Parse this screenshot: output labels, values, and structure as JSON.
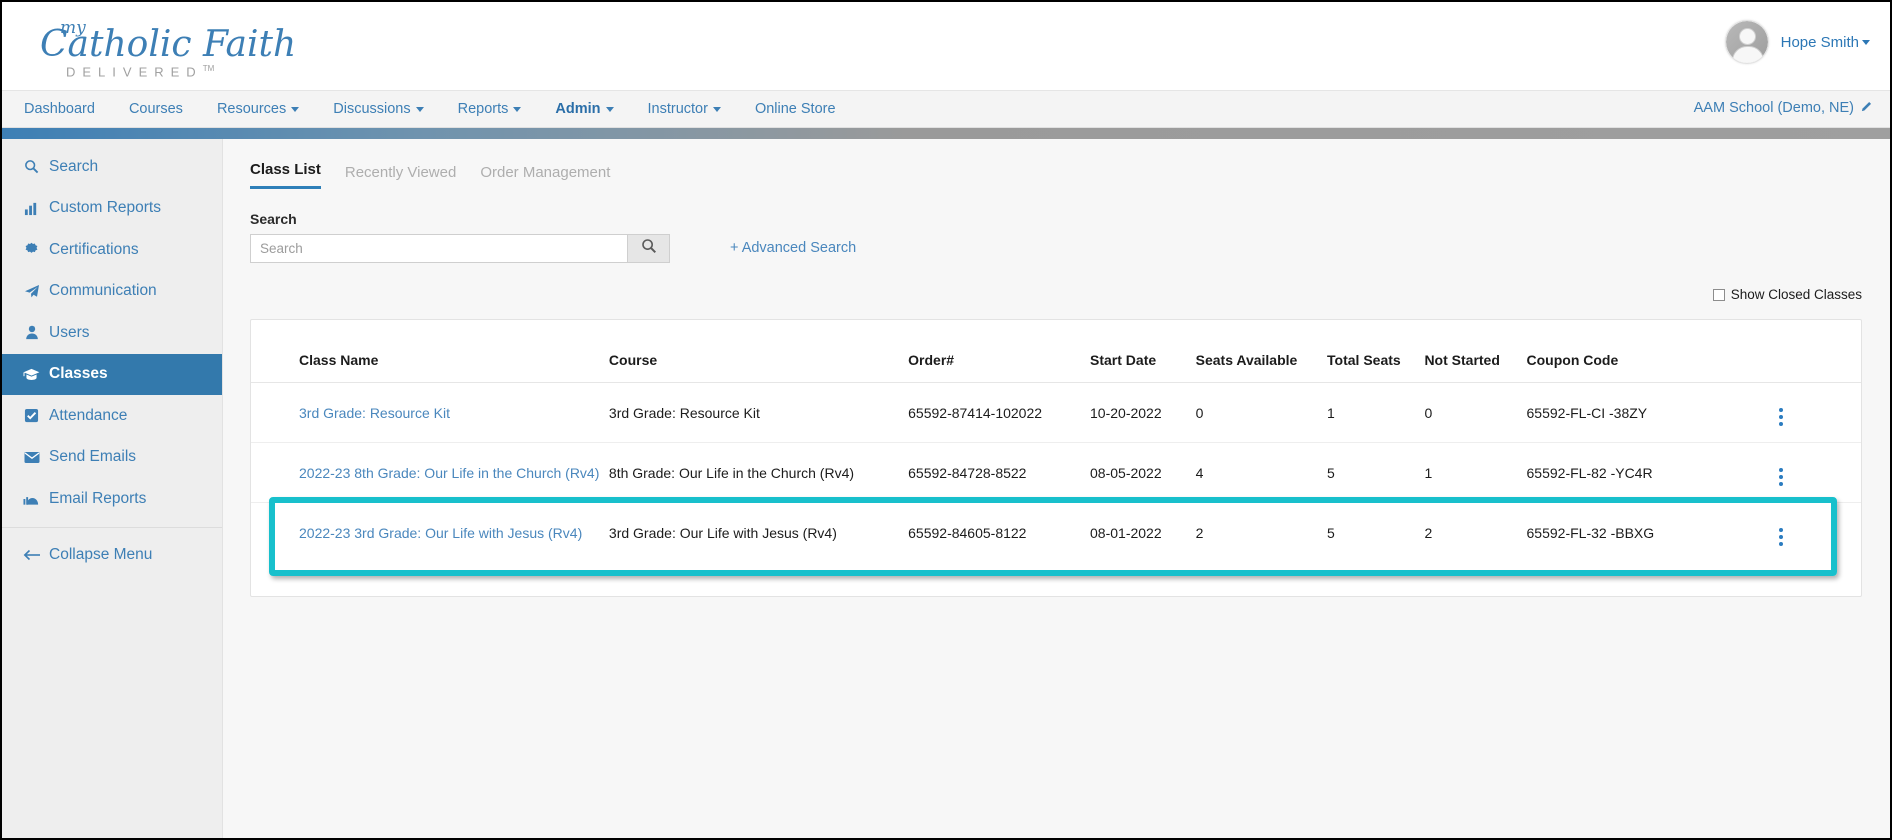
{
  "brand": {
    "logo_my": "my",
    "logo_main": "Catholic Faith",
    "logo_sub": "DELIVERED",
    "logo_tm": "TM",
    "accent_blue": "#3d7fb5",
    "accent_teal": "#18c0cc",
    "active_nav_bg": "#3379ac"
  },
  "header": {
    "user_name": "Hope Smith",
    "user_caret": "caret-down-icon",
    "avatar": "user-avatar"
  },
  "navbar": {
    "items": [
      {
        "label": "Dashboard",
        "caret": false,
        "active": false
      },
      {
        "label": "Courses",
        "caret": false,
        "active": false
      },
      {
        "label": "Resources",
        "caret": true,
        "active": false
      },
      {
        "label": "Discussions",
        "caret": true,
        "active": false
      },
      {
        "label": "Reports",
        "caret": true,
        "active": false
      },
      {
        "label": "Admin",
        "caret": true,
        "active": true
      },
      {
        "label": "Instructor",
        "caret": true,
        "active": false
      },
      {
        "label": "Online Store",
        "caret": false,
        "active": false
      }
    ],
    "school": "AAM School (Demo, NE)",
    "school_edit_icon": "pencil-icon"
  },
  "sidebar": {
    "items": [
      {
        "label": "Search",
        "icon": "magnifier-icon",
        "active": false
      },
      {
        "label": "Custom Reports",
        "icon": "bar-chart-icon",
        "active": false
      },
      {
        "label": "Certifications",
        "icon": "badge-seal-icon",
        "active": false
      },
      {
        "label": "Communication",
        "icon": "paper-plane-icon",
        "active": false
      },
      {
        "label": "Users",
        "icon": "person-icon",
        "active": false
      },
      {
        "label": "Classes",
        "icon": "graduation-cap-icon",
        "active": true
      },
      {
        "label": "Attendance",
        "icon": "checkbox-checked-icon",
        "active": false
      },
      {
        "label": "Send Emails",
        "icon": "envelope-icon",
        "active": false
      },
      {
        "label": "Email Reports",
        "icon": "chart-cloud-icon",
        "active": false
      }
    ],
    "collapse": {
      "label": "Collapse Menu",
      "icon": "arrow-left-icon"
    }
  },
  "main": {
    "tabs": [
      {
        "label": "Class List",
        "active": true
      },
      {
        "label": "Recently Viewed",
        "active": false
      },
      {
        "label": "Order Management",
        "active": false
      }
    ],
    "search": {
      "label": "Search",
      "value": "",
      "placeholder": "Search",
      "button_icon": "magnifier-icon",
      "advanced_link": "+ Advanced Search"
    },
    "show_closed": {
      "label": "Show Closed Classes",
      "checked": false
    },
    "table": {
      "columns": [
        "Class Name",
        "Course",
        "Order#",
        "Start Date",
        "Seats Available",
        "Total Seats",
        "Not Started",
        "Coupon Code"
      ],
      "rows": [
        {
          "class_name": "3rd Grade: Resource Kit",
          "course": "3rd Grade: Resource Kit",
          "order": "65592-87414-102022",
          "start_date": "10-20-2022",
          "seats_available": "0",
          "total_seats": "1",
          "not_started": "0",
          "coupon_code": "65592-FL-CI -38ZY",
          "menu_icon": "kebab-menu-icon",
          "highlighted": false
        },
        {
          "class_name": "2022-23 8th Grade: Our Life in the Church (Rv4)",
          "course": "8th Grade: Our Life in the Church (Rv4)",
          "order": "65592-84728-8522",
          "start_date": "08-05-2022",
          "seats_available": "4",
          "total_seats": "5",
          "not_started": "1",
          "coupon_code": "65592-FL-82 -YC4R",
          "menu_icon": "kebab-menu-icon",
          "highlighted": false
        },
        {
          "class_name": "2022-23 3rd Grade: Our Life with Jesus (Rv4)",
          "course": "3rd Grade: Our Life with Jesus (Rv4)",
          "order": "65592-84605-8122",
          "start_date": "08-01-2022",
          "seats_available": "2",
          "total_seats": "5",
          "not_started": "2",
          "coupon_code": "65592-FL-32 -BBXG",
          "menu_icon": "kebab-menu-icon",
          "highlighted": true
        }
      ]
    }
  }
}
